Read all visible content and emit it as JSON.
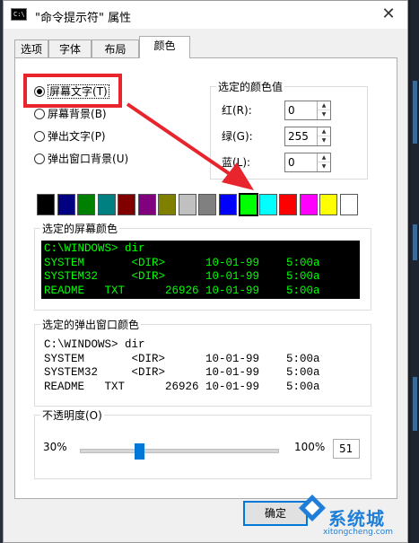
{
  "window": {
    "title": "\"命令提示符\" 属性",
    "app_icon_text": "C:\\",
    "close_glyph": "✕"
  },
  "tabs": [
    {
      "label": "选项",
      "active": false
    },
    {
      "label": "字体",
      "active": false
    },
    {
      "label": "布局",
      "active": false
    },
    {
      "label": "颜色",
      "active": true
    }
  ],
  "targets": [
    {
      "label": "屏幕文字",
      "accel": "(T)",
      "checked": true
    },
    {
      "label": "屏幕背景",
      "accel": "(B)",
      "checked": false
    },
    {
      "label": "弹出文字",
      "accel": "(P)",
      "checked": false
    },
    {
      "label": "弹出窗口背景",
      "accel": "(U)",
      "checked": false
    }
  ],
  "color_values": {
    "group_title": "选定的颜色值",
    "rows": [
      {
        "label": "红(R):",
        "value": "0"
      },
      {
        "label": "绿(G):",
        "value": "255"
      },
      {
        "label": "蓝(L):",
        "value": "0"
      }
    ]
  },
  "palette": [
    "#000000",
    "#000080",
    "#008000",
    "#008080",
    "#800000",
    "#800080",
    "#808000",
    "#c0c0c0",
    "#808080",
    "#0000ff",
    "#00ff00",
    "#00ffff",
    "#ff0000",
    "#ff00ff",
    "#ffff00",
    "#ffffff"
  ],
  "palette_selected_index": 10,
  "screen_preview": {
    "title": "选定的屏幕颜色",
    "bg": "#000000",
    "fg": "#00ff00",
    "lines": [
      "C:\\WINDOWS> dir",
      "SYSTEM       <DIR>      10-01-99    5:00a",
      "SYSTEM32     <DIR>      10-01-99    5:00a",
      "README   TXT      26926 10-01-99    5:00a"
    ]
  },
  "popup_preview": {
    "title": "选定的弹出窗口颜色",
    "bg": "#ffffff",
    "fg": "#000000",
    "lines": [
      "C:\\WINDOWS> dir",
      "SYSTEM       <DIR>      10-01-99    5:00a",
      "SYSTEM32     <DIR>      10-01-99    5:00a",
      "README   TXT      26926 10-01-99    5:00a"
    ]
  },
  "opacity": {
    "title": "不透明度(O)",
    "min_label": "30%",
    "max_label": "100%",
    "value": "51",
    "percent": 51
  },
  "ok_button": {
    "label": "确定"
  },
  "watermark": {
    "text": "系统城",
    "url": "xitongcheng.com"
  },
  "colors": {
    "annotation_red": "#e8242d",
    "accent": "#0078d7"
  }
}
